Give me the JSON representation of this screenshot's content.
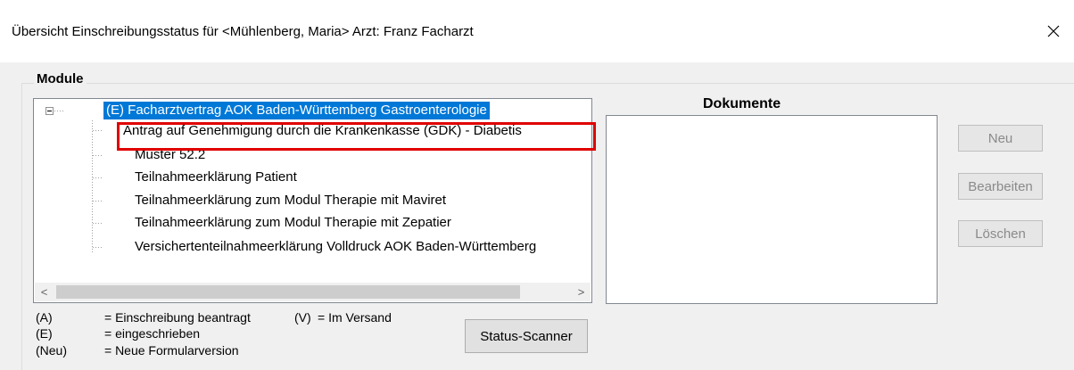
{
  "window": {
    "title": "Übersicht Einschreibungsstatus für <Mühlenberg, Maria> Arzt: Franz Facharzt",
    "close_glyph": "✕"
  },
  "modules": {
    "label": "Module",
    "root": "(E) Facharztvertrag AOK Baden-Württemberg Gastroenterologie",
    "items": [
      "Antrag auf Genehmigung durch die Krankenkasse (GDK) - Diabetis",
      "Muster 52.2",
      "Teilnahmeerklärung Patient",
      "Teilnahmeerklärung zum Modul Therapie mit Maviret",
      "Teilnahmeerklärung zum Modul Therapie mit Zepatier",
      "Versichertenteilnahmeerklärung Volldruck AOK Baden-Württemberg"
    ],
    "scroll_left": "<",
    "scroll_right": ">"
  },
  "documents": {
    "title": "Dokumente"
  },
  "buttons": {
    "neu": "Neu",
    "bearbeiten": "Bearbeiten",
    "loeschen": "Löschen",
    "status_scanner": "Status-Scanner"
  },
  "legend": {
    "a_code": "(A)",
    "a_text": "= Einschreibung beantragt",
    "v_code": "(V)",
    "v_text": "= Im Versand",
    "e_code": "(E)",
    "e_text": "= eingeschrieben",
    "neu_code": "(Neu)",
    "neu_text": "= Neue Formularversion"
  },
  "colors": {
    "selection": "#0078d7",
    "highlight_border": "#e00000"
  }
}
